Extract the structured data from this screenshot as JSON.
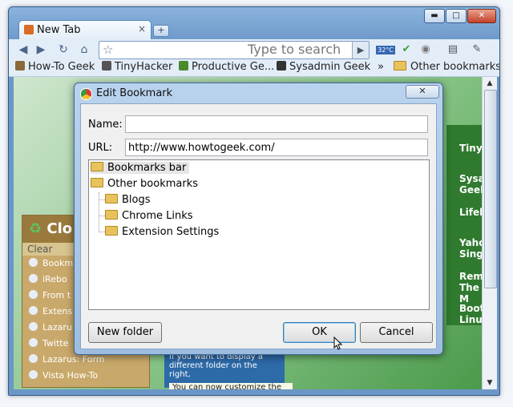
{
  "browser": {
    "tab_title": "New Tab",
    "tab_close": "×",
    "new_tab": "+",
    "window_controls": {
      "minimize": "▬",
      "maximize": "□",
      "close": "✕"
    },
    "omnibox_placeholder": "Type to search",
    "weather_temp": "32°C"
  },
  "bookmarks_bar": {
    "items": [
      "How-To Geek",
      "TinyHacker",
      "Productive Ge...",
      "Sysadmin Geek"
    ],
    "overflow": "»",
    "other_bookmarks": "Other bookmarks"
  },
  "background_page": {
    "panel_title": "Clo",
    "clear_label": "Clear",
    "list_items": [
      "Bookm",
      "iRebo",
      "From t",
      "Extens",
      "Lazaru",
      "Twitte",
      "Lazarus: Form",
      "Vista How-To"
    ],
    "right_links": [
      "TinyH",
      "Sysad Geek",
      "Lifeh",
      "Yahoo Singa",
      "Reme The M",
      "Boot Linux"
    ],
    "tooltip_text": "If you want to display a different folder on the right,",
    "tooltip_text2": "You can now customize the folder shown"
  },
  "dialog": {
    "title": "Edit Bookmark",
    "close": "✕",
    "name_label": "Name:",
    "name_value": "",
    "url_label": "URL:",
    "url_value": "http://www.howtogeek.com/",
    "tree": {
      "root1": "Bookmarks bar",
      "root2": "Other bookmarks",
      "children": [
        "Blogs",
        "Chrome Links",
        "Extension Settings"
      ]
    },
    "new_folder_label": "New folder",
    "ok_label": "OK",
    "cancel_label": "Cancel"
  },
  "colors": {
    "window_frame": "#6a97c7",
    "dialog_frame": "#9dbde0",
    "page_green": "#4c9a4c"
  }
}
